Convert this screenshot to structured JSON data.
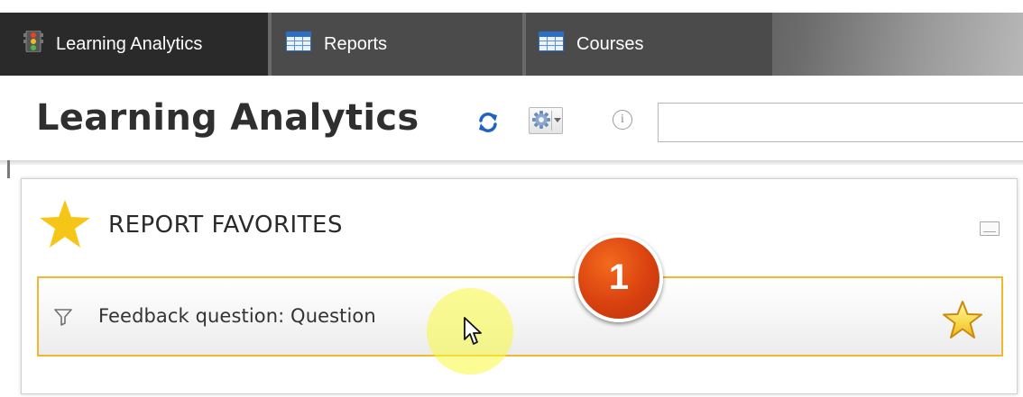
{
  "tabs": [
    {
      "label": "Learning Analytics",
      "icon": "traffic-light-icon"
    },
    {
      "label": "Reports",
      "icon": "table-grid-icon"
    },
    {
      "label": "Courses",
      "icon": "table-grid-icon"
    }
  ],
  "header": {
    "title": "Learning Analytics",
    "refresh_icon": "refresh-icon",
    "settings_icon": "gear-icon",
    "info_icon": "info-icon",
    "info_glyph": "i",
    "search": {
      "value": "",
      "placeholder": ""
    }
  },
  "favorites": {
    "title": "REPORT FAVORITES",
    "items": [
      {
        "label": "Feedback question: Question",
        "icon": "filter-icon",
        "favorite_icon": "star-icon"
      }
    ]
  },
  "annotation": {
    "step_number": "1"
  },
  "colors": {
    "tab_bar": "#454545",
    "active_tab": "#2a2a2a",
    "title_text": "#2f2f2f",
    "accent_star": "#f5c518",
    "row_border": "#f2b730",
    "step_badge": "#d94110",
    "cursor_highlight": "#fafa3c"
  }
}
